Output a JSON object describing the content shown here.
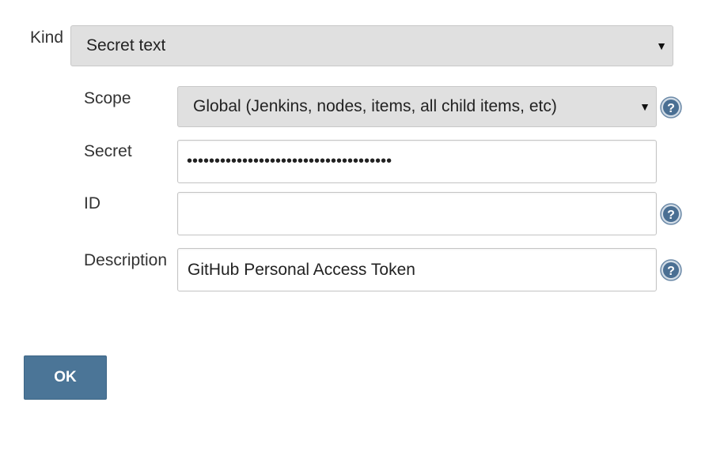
{
  "form": {
    "kind": {
      "label": "Kind",
      "value": "Secret text"
    },
    "scope": {
      "label": "Scope",
      "value": "Global (Jenkins, nodes, items, all child items, etc)",
      "help_icon": "question-mark-icon"
    },
    "secret": {
      "label": "Secret",
      "value": "•••••••••••••••••••••••••••••••••••••"
    },
    "id": {
      "label": "ID",
      "value": "",
      "help_icon": "question-mark-icon"
    },
    "description": {
      "label": "Description",
      "value": "GitHub Personal Access Token",
      "help_icon": "question-mark-icon"
    }
  },
  "actions": {
    "ok_label": "OK"
  },
  "colors": {
    "button": "#4b7597",
    "help_icon": "#4a6f93",
    "select_background": "#e0e0e0"
  }
}
